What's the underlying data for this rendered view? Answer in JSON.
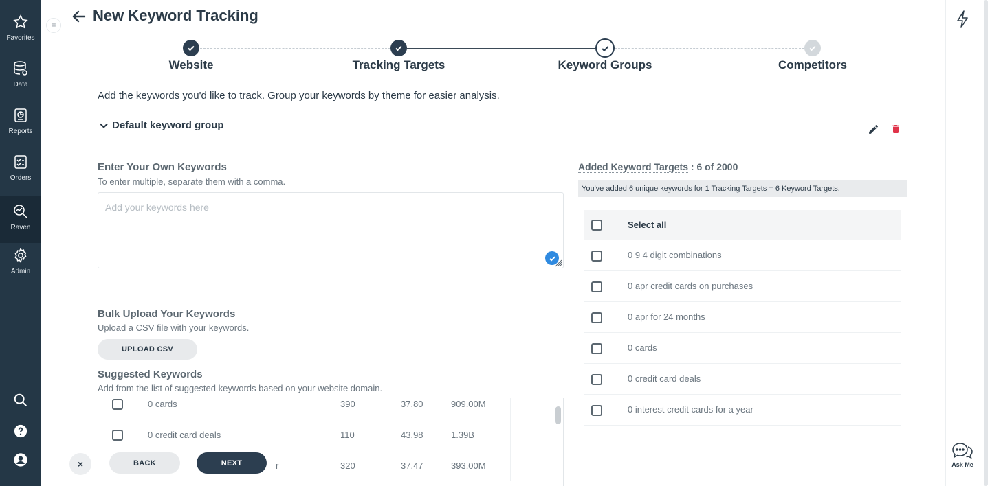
{
  "nav": {
    "items": [
      {
        "label": "Favorites",
        "icon": "star-icon"
      },
      {
        "label": "Data",
        "icon": "database-icon"
      },
      {
        "label": "Reports",
        "icon": "report-icon"
      },
      {
        "label": "Orders",
        "icon": "clipboard-icon"
      },
      {
        "label": "Raven",
        "icon": "raven-icon"
      },
      {
        "label": "Admin",
        "icon": "gear-icon"
      }
    ],
    "active": "Raven"
  },
  "header": {
    "title": "New Keyword Tracking"
  },
  "stepper": {
    "steps": [
      {
        "label": "Website",
        "state": "done"
      },
      {
        "label": "Tracking Targets",
        "state": "done"
      },
      {
        "label": "Keyword Groups",
        "state": "current"
      },
      {
        "label": "Competitors",
        "state": "todo"
      }
    ]
  },
  "intro": "Add the keywords you'd like to track. Group your keywords by theme for easier analysis.",
  "group": {
    "name": "Default keyword group"
  },
  "manual": {
    "title": "Enter Your Own Keywords",
    "subtitle": "To enter multiple, separate them with a comma.",
    "placeholder": "Add your keywords here"
  },
  "bulk": {
    "title": "Bulk Upload Your Keywords",
    "subtitle": "Upload a CSV file with your keywords.",
    "button": "UPLOAD CSV"
  },
  "suggested": {
    "title": "Suggested Keywords",
    "subtitle": "Add from the list of suggested keywords based on your website domain.",
    "rows": [
      {
        "keyword": "0 cards",
        "volume": "390",
        "cpc": "37.80",
        "results": "909.00M"
      },
      {
        "keyword": "0 credit card deals",
        "volume": "110",
        "cpc": "43.98",
        "results": "1.39B"
      },
      {
        "keyword": "r",
        "volume": "320",
        "cpc": "37.47",
        "results": "393.00M"
      }
    ]
  },
  "footer": {
    "close": "×",
    "back": "BACK",
    "next": "NEXT"
  },
  "added": {
    "label": "Added Keyword Targets",
    "count": ": 6 of 2000",
    "info": "You've added 6 unique keywords for 1 Tracking Targets = 6 Keyword Targets.",
    "select_all": "Select all",
    "keywords": [
      "0 9 4 digit combinations",
      "0 apr credit cards on purchases",
      "0 apr for 24 months",
      "0 cards",
      "0 credit card deals",
      "0 interest credit cards for a year"
    ]
  },
  "rail": {
    "ask_me": "Ask Me"
  },
  "colors": {
    "nav_bg": "#243746",
    "primary": "#2c3e50",
    "delete": "#e0334a",
    "check_blue": "#2f8ae0"
  }
}
